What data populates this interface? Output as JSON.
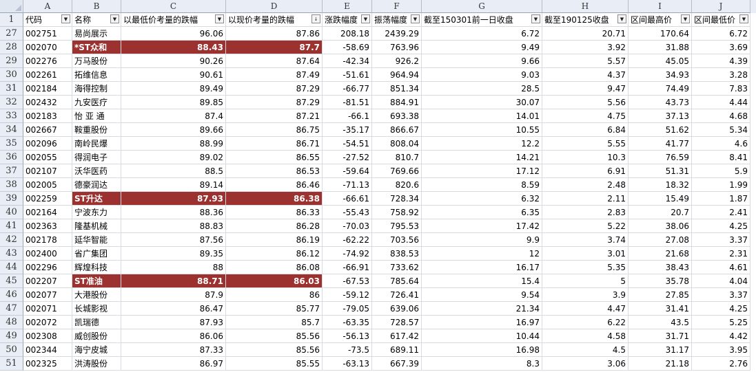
{
  "sheet": {
    "columns": [
      "A",
      "B",
      "C",
      "D",
      "E",
      "F",
      "G",
      "H",
      "I",
      "J"
    ],
    "header_row_number": "1",
    "headers": [
      "代码",
      "名称",
      "以最低价考量的跌幅",
      "以现价考量的跌幅",
      "涨跌幅度",
      "振荡幅度",
      "截至150301前一日收盘",
      "截至190125收盘",
      "区间最高价",
      "区间最低价"
    ],
    "filter_icons": [
      "dropdown-icon",
      "dropdown-icon",
      "dropdown-icon",
      "sort-descending-filter-icon",
      "dropdown-icon",
      "dropdown-icon",
      "dropdown-icon",
      "dropdown-icon",
      "dropdown-icon",
      "dropdown-icon"
    ],
    "highlight_color": "#9b3230",
    "rows": [
      {
        "n": "27",
        "code": "002751",
        "name": "易尚展示",
        "c": "96.06",
        "d": "87.86",
        "e": "208.18",
        "f": "2439.29",
        "g": "6.72",
        "h": "20.71",
        "i": "170.64",
        "j": "6.72",
        "hl": false
      },
      {
        "n": "28",
        "code": "002070",
        "name": "*ST众和",
        "c": "88.43",
        "d": "87.7",
        "e": "-58.69",
        "f": "763.96",
        "g": "9.49",
        "h": "3.92",
        "i": "31.88",
        "j": "3.69",
        "hl": true
      },
      {
        "n": "29",
        "code": "002276",
        "name": "万马股份",
        "c": "90.26",
        "d": "87.64",
        "e": "-42.34",
        "f": "926.2",
        "g": "9.66",
        "h": "5.57",
        "i": "45.05",
        "j": "4.39",
        "hl": false
      },
      {
        "n": "30",
        "code": "002261",
        "name": "拓维信息",
        "c": "90.61",
        "d": "87.49",
        "e": "-51.61",
        "f": "964.94",
        "g": "9.03",
        "h": "4.37",
        "i": "34.93",
        "j": "3.28",
        "hl": false
      },
      {
        "n": "31",
        "code": "002184",
        "name": "海得控制",
        "c": "89.49",
        "d": "87.29",
        "e": "-66.77",
        "f": "851.34",
        "g": "28.5",
        "h": "9.47",
        "i": "74.49",
        "j": "7.83",
        "hl": false
      },
      {
        "n": "32",
        "code": "002432",
        "name": "九安医疗",
        "c": "89.85",
        "d": "87.29",
        "e": "-81.51",
        "f": "884.91",
        "g": "30.07",
        "h": "5.56",
        "i": "43.73",
        "j": "4.44",
        "hl": false
      },
      {
        "n": "33",
        "code": "002183",
        "name": "怡 亚 通",
        "c": "87.4",
        "d": "87.21",
        "e": "-66.1",
        "f": "693.38",
        "g": "14.01",
        "h": "4.75",
        "i": "37.13",
        "j": "4.68",
        "hl": false
      },
      {
        "n": "34",
        "code": "002667",
        "name": "鞍重股份",
        "c": "89.66",
        "d": "86.75",
        "e": "-35.17",
        "f": "866.67",
        "g": "10.55",
        "h": "6.84",
        "i": "51.62",
        "j": "5.34",
        "hl": false
      },
      {
        "n": "35",
        "code": "002096",
        "name": "南岭民爆",
        "c": "88.99",
        "d": "86.71",
        "e": "-54.51",
        "f": "808.04",
        "g": "12.2",
        "h": "5.55",
        "i": "41.77",
        "j": "4.6",
        "hl": false
      },
      {
        "n": "36",
        "code": "002055",
        "name": "得润电子",
        "c": "89.02",
        "d": "86.55",
        "e": "-27.52",
        "f": "810.7",
        "g": "14.21",
        "h": "10.3",
        "i": "76.59",
        "j": "8.41",
        "hl": false
      },
      {
        "n": "37",
        "code": "002107",
        "name": "沃华医药",
        "c": "88.5",
        "d": "86.53",
        "e": "-59.64",
        "f": "769.66",
        "g": "17.12",
        "h": "6.91",
        "i": "51.31",
        "j": "5.9",
        "hl": false
      },
      {
        "n": "38",
        "code": "002005",
        "name": "德豪润达",
        "c": "89.14",
        "d": "86.46",
        "e": "-71.13",
        "f": "820.6",
        "g": "8.59",
        "h": "2.48",
        "i": "18.32",
        "j": "1.99",
        "hl": false
      },
      {
        "n": "39",
        "code": "002259",
        "name": "ST升达",
        "c": "87.93",
        "d": "86.38",
        "e": "-66.61",
        "f": "728.34",
        "g": "6.32",
        "h": "2.11",
        "i": "15.49",
        "j": "1.87",
        "hl": true
      },
      {
        "n": "40",
        "code": "002164",
        "name": "宁波东力",
        "c": "88.36",
        "d": "86.33",
        "e": "-55.43",
        "f": "758.92",
        "g": "6.35",
        "h": "2.83",
        "i": "20.7",
        "j": "2.41",
        "hl": false
      },
      {
        "n": "41",
        "code": "002363",
        "name": "隆基机械",
        "c": "88.83",
        "d": "86.28",
        "e": "-70.03",
        "f": "795.53",
        "g": "17.42",
        "h": "5.22",
        "i": "38.06",
        "j": "4.25",
        "hl": false
      },
      {
        "n": "42",
        "code": "002178",
        "name": "延华智能",
        "c": "87.56",
        "d": "86.19",
        "e": "-62.22",
        "f": "703.56",
        "g": "9.9",
        "h": "3.74",
        "i": "27.08",
        "j": "3.37",
        "hl": false
      },
      {
        "n": "43",
        "code": "002400",
        "name": "省广集团",
        "c": "89.35",
        "d": "86.12",
        "e": "-74.92",
        "f": "838.53",
        "g": "12",
        "h": "3.01",
        "i": "21.68",
        "j": "2.31",
        "hl": false
      },
      {
        "n": "44",
        "code": "002296",
        "name": "辉煌科技",
        "c": "88",
        "d": "86.08",
        "e": "-66.91",
        "f": "733.62",
        "g": "16.17",
        "h": "5.35",
        "i": "38.43",
        "j": "4.61",
        "hl": false
      },
      {
        "n": "45",
        "code": "002207",
        "name": "ST准油",
        "c": "88.71",
        "d": "86.03",
        "e": "-67.53",
        "f": "785.64",
        "g": "15.4",
        "h": "5",
        "i": "35.78",
        "j": "4.04",
        "hl": true
      },
      {
        "n": "46",
        "code": "002077",
        "name": "大港股份",
        "c": "87.9",
        "d": "86",
        "e": "-59.12",
        "f": "726.41",
        "g": "9.54",
        "h": "3.9",
        "i": "27.85",
        "j": "3.37",
        "hl": false
      },
      {
        "n": "47",
        "code": "002071",
        "name": "长城影视",
        "c": "86.47",
        "d": "85.77",
        "e": "-79.05",
        "f": "639.06",
        "g": "21.34",
        "h": "4.47",
        "i": "31.41",
        "j": "4.25",
        "hl": false
      },
      {
        "n": "48",
        "code": "002072",
        "name": "凯瑞德",
        "c": "87.93",
        "d": "85.7",
        "e": "-63.35",
        "f": "728.57",
        "g": "16.97",
        "h": "6.22",
        "i": "43.5",
        "j": "5.25",
        "hl": false
      },
      {
        "n": "49",
        "code": "002308",
        "name": "威创股份",
        "c": "86.06",
        "d": "85.56",
        "e": "-56.13",
        "f": "617.42",
        "g": "10.44",
        "h": "4.58",
        "i": "31.71",
        "j": "4.42",
        "hl": false
      },
      {
        "n": "50",
        "code": "002344",
        "name": "海宁皮城",
        "c": "87.33",
        "d": "85.56",
        "e": "-73.5",
        "f": "689.11",
        "g": "16.98",
        "h": "4.5",
        "i": "31.17",
        "j": "3.95",
        "hl": false
      },
      {
        "n": "51",
        "code": "002325",
        "name": "洪涛股份",
        "c": "86.97",
        "d": "85.55",
        "e": "-63.13",
        "f": "667.39",
        "g": "8.3",
        "h": "3.06",
        "i": "21.18",
        "j": "2.76",
        "hl": false
      }
    ]
  }
}
